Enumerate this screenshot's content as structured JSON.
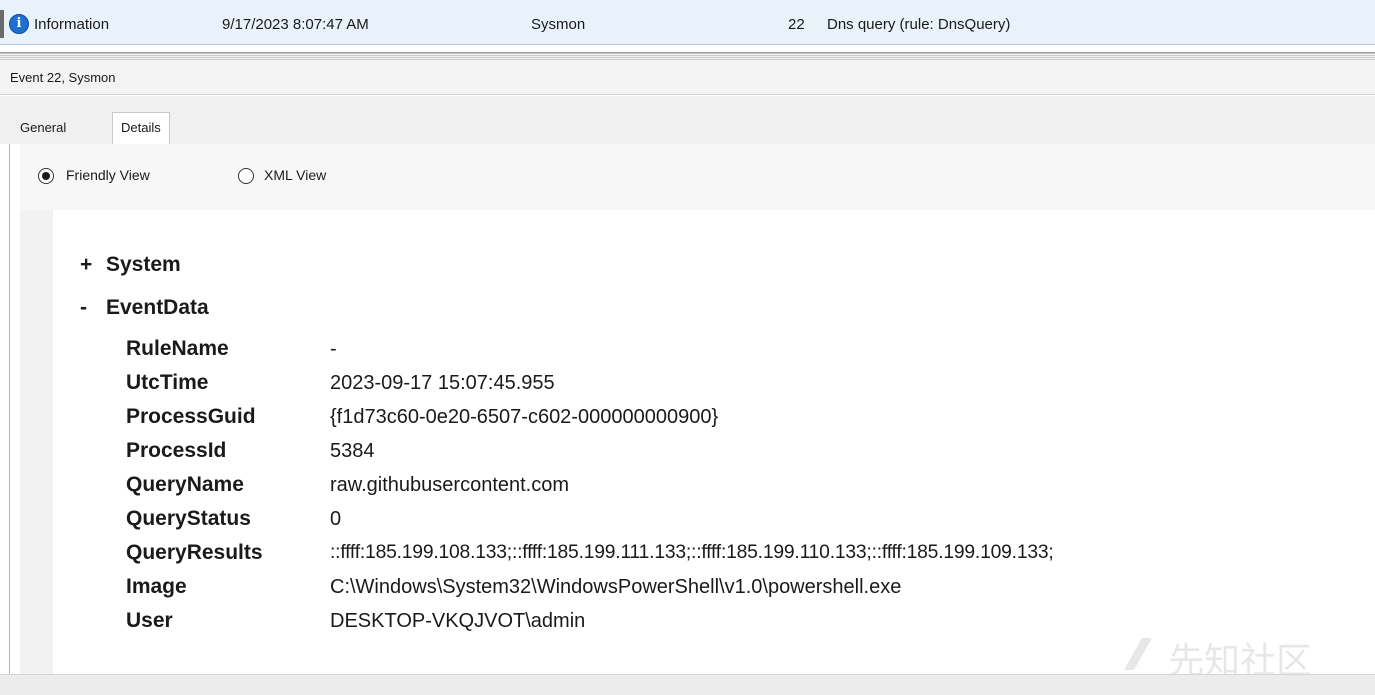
{
  "event_row": {
    "level": "Information",
    "date_time": "9/17/2023 8:07:47 AM",
    "source": "Sysmon",
    "event_id": "22",
    "task_category": "Dns query (rule: DnsQuery)"
  },
  "event_title": "Event 22, Sysmon",
  "tabs": [
    {
      "label": "General"
    },
    {
      "label": "Details"
    }
  ],
  "view_options": {
    "friendly_view": "Friendly View",
    "xml_view": "XML View",
    "selected": "Friendly View"
  },
  "tree": {
    "system": {
      "toggle": "+",
      "label": "System"
    },
    "event_data": {
      "toggle": "-",
      "label": "EventData"
    }
  },
  "fields": [
    {
      "name": "RuleName",
      "value": "-"
    },
    {
      "name": "UtcTime",
      "value": "2023-09-17 15:07:45.955"
    },
    {
      "name": "ProcessGuid",
      "value": "{f1d73c60-0e20-6507-c602-000000000900}"
    },
    {
      "name": "ProcessId",
      "value": "5384"
    },
    {
      "name": "QueryName",
      "value": "raw.githubusercontent.com"
    },
    {
      "name": "QueryStatus",
      "value": "0"
    },
    {
      "name": "QueryResults",
      "value": "::ffff:185.199.108.133;::ffff:185.199.111.133;::ffff:185.199.110.133;::ffff:185.199.109.133;"
    },
    {
      "name": "Image",
      "value": "C:\\Windows\\System32\\WindowsPowerShell\\v1.0\\powershell.exe"
    },
    {
      "name": "User",
      "value": "DESKTOP-VKQJVOT\\admin"
    }
  ],
  "watermark": "先知社区",
  "icons": {
    "info": "info-icon",
    "radio_checked": "radio-checked-icon",
    "radio_unchecked": "radio-unchecked-icon"
  },
  "colors": {
    "selected_row": "#e9f2fb",
    "info_icon": "#1f6fd1"
  }
}
